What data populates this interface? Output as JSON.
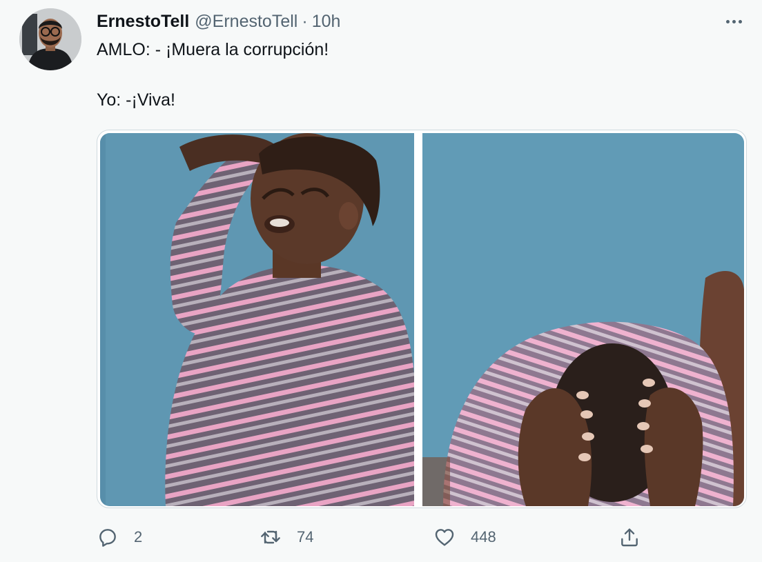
{
  "tweet": {
    "author_name": "ErnestoTell",
    "author_handle": "@ErnestoTell",
    "separator": "·",
    "timestamp": "10h",
    "text_lines": [
      "AMLO: - ¡Muera la corrupción!",
      "Yo: -¡Viva!"
    ]
  },
  "media": {
    "panels": [
      "crying-child-meme-left",
      "crying-child-meme-right"
    ]
  },
  "actions": {
    "reply_count": "2",
    "retweet_count": "74",
    "like_count": "448"
  },
  "icons": {
    "more": "more-horizontal-icon",
    "reply": "reply-icon",
    "retweet": "retweet-icon",
    "like": "heart-icon",
    "share": "share-icon"
  },
  "colors": {
    "text_primary": "#0f1419",
    "text_secondary": "#536471",
    "background": "#f7f9f9",
    "border": "#cfd9de",
    "meme_background": "#5c96b2"
  }
}
